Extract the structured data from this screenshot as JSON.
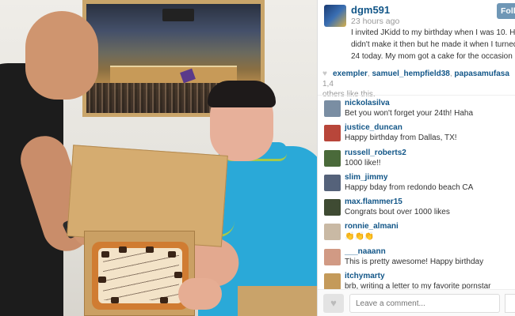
{
  "post": {
    "username": "dgm591",
    "time_ago": "23 hours ago",
    "follow_label": "Follow",
    "caption": "I invited JKidd to my birthday when I was 10. He didn't make it then but he made it when I turned 24 today. My mom got a cake for the occasion",
    "photo_icon": "basketball-photo"
  },
  "likes": {
    "likers": [
      "exempler",
      "samuel_hempfield38",
      "papasamufasa"
    ],
    "count_fragment": "1,4",
    "suffix": "others like this."
  },
  "comments": [
    {
      "user": "nickolasilva",
      "text": "Bet you won't forget your 24th! Haha",
      "avatar_color": "#7a8ea3"
    },
    {
      "user": "justice_duncan",
      "text": "Happy birthday from Dallas, TX!",
      "avatar_color": "#b8463a"
    },
    {
      "user": "russell_roberts2",
      "text": "1000 like!!",
      "avatar_color": "#4a6a3a"
    },
    {
      "user": "slim_jimmy",
      "text": "Happy bday from redondo beach CA",
      "avatar_color": "#55627a"
    },
    {
      "user": "max.flammer15",
      "text": "Congrats bout over 1000 likes",
      "avatar_color": "#3f4b33"
    },
    {
      "user": "ronnie_almani",
      "text": "👏👏👏",
      "avatar_color": "#c9b9a4"
    },
    {
      "user": "___naaann",
      "text": "This is pretty awesome! Happy birthday",
      "avatar_color": "#d19a84"
    },
    {
      "user": "itchymarty",
      "text": "brb, writing a letter to my favorite pornstar",
      "avatar_color": "#c49a5a"
    }
  ],
  "footer": {
    "comment_placeholder": "Leave a comment...",
    "like_icon": "heart-icon"
  },
  "colors": {
    "link_blue": "#125688",
    "follow_button": "#6f97b6"
  }
}
